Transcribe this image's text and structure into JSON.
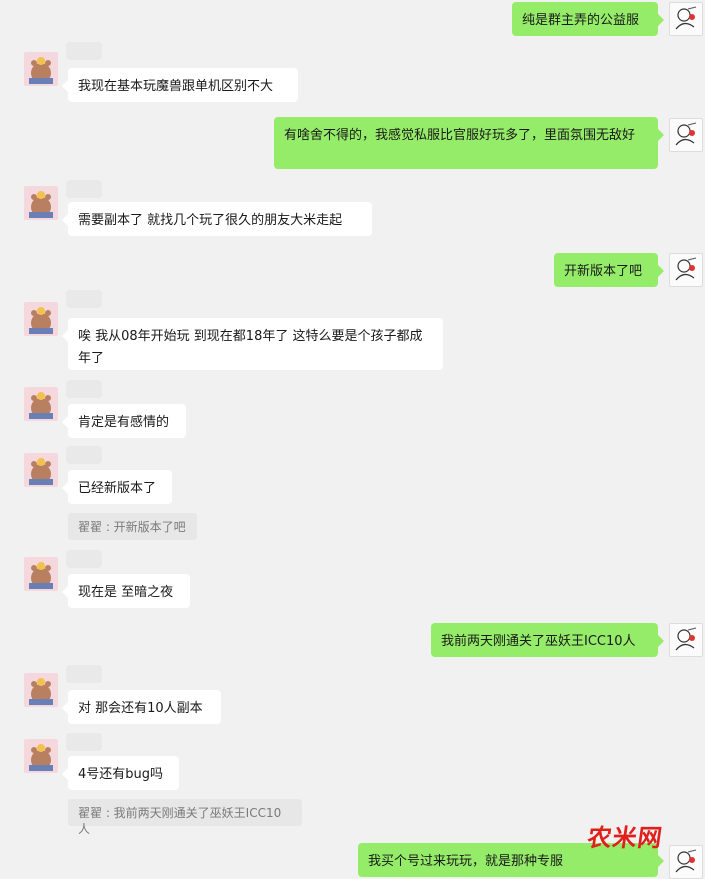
{
  "colors": {
    "background": "#f1f1f1",
    "my_bubble": "#95ec69",
    "peer_bubble": "#ffffff",
    "quote_bg": "#e7e7e7",
    "watermark": "#e0211b"
  },
  "messages": [
    {
      "side": "me",
      "text": "纯是群主弄的公益服"
    },
    {
      "side": "peer",
      "text": "我现在基本玩魔兽跟单机区别不大"
    },
    {
      "side": "me",
      "text": "有啥舍不得的，我感觉私服比官服好玩多了，里面氛围无敌好"
    },
    {
      "side": "peer",
      "text": "需要副本了 就找几个玩了很久的朋友大米走起"
    },
    {
      "side": "me",
      "text": "开新版本了吧"
    },
    {
      "side": "peer",
      "text": "唉  我从08年开始玩   到现在都18年了    这特么要是个孩子都成年了"
    },
    {
      "side": "peer",
      "text": "肯定是有感情的"
    },
    {
      "side": "peer",
      "text": "已经新版本了",
      "quote": "翟翟 : 开新版本了吧"
    },
    {
      "side": "peer",
      "text": "现在是 至暗之夜"
    },
    {
      "side": "me",
      "text": "我前两天刚通关了巫妖王ICC10人"
    },
    {
      "side": "peer",
      "text": "对 那会还有10人副本"
    },
    {
      "side": "peer",
      "text": "4号还有bug吗",
      "quote": "翟翟 : 我前两天刚通关了巫妖王ICC10人"
    },
    {
      "side": "me",
      "text": "我买个号过来玩玩，就是那种专服"
    }
  ],
  "avatars": {
    "peer": "cartoon-bear-avatar",
    "me": "sketch-girl-avatar"
  },
  "watermark_text": "农米网"
}
